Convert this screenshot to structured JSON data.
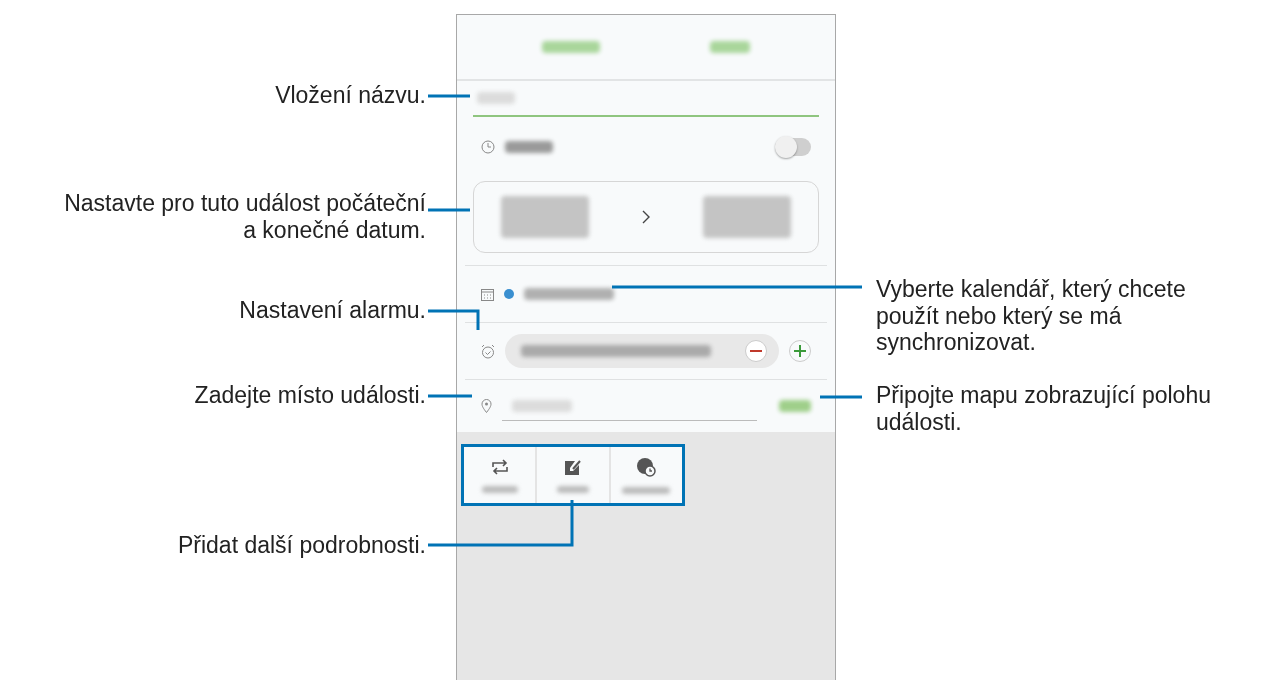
{
  "phone": {
    "all_day_toggle": {
      "on": false
    }
  },
  "left_callouts": [
    {
      "lines": [
        "Vložení názvu."
      ]
    },
    {
      "lines": [
        "Nastavte pro tuto událost počáteční",
        "a konečné datum."
      ]
    },
    {
      "lines": [
        "Nastavení alarmu."
      ]
    },
    {
      "lines": [
        "Zadejte místo události."
      ]
    },
    {
      "lines": [
        "Přidat další podrobnosti."
      ]
    }
  ],
  "right_callouts": [
    {
      "lines": [
        "Vyberte kalendář, který chcete",
        "použít nebo který se má",
        "synchronizovat."
      ]
    },
    {
      "lines": [
        "Připojte mapu zobrazující polohu",
        "události."
      ]
    }
  ]
}
